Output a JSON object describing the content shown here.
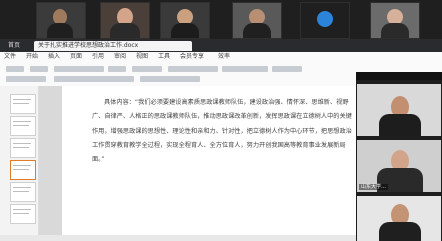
{
  "gallery": {
    "participants": [
      {
        "name": "",
        "label_icon": "user-video"
      },
      {
        "name": "",
        "label_icon": "user-video"
      },
      {
        "name": "",
        "label_icon": "user-video"
      },
      {
        "name": "",
        "label_icon": "user-video"
      },
      {
        "name": "",
        "label_icon": "user-video"
      },
      {
        "name": "",
        "label_icon": "user-video"
      },
      {
        "name": "",
        "label_icon": "user-video"
      },
      {
        "name": "",
        "label_icon": "user-video"
      }
    ]
  },
  "wps": {
    "tabs": [
      "首页",
      "关于扎实推进学校思想政治工作.docx"
    ],
    "menus": [
      "文件",
      "开始",
      "插入",
      "页面",
      "引用",
      "审阅",
      "视图",
      "工具",
      "会员专享",
      "效率"
    ],
    "doc": {
      "paragraph": "具体内容：“我们必须要建设高素质思政课教师队伍，建设政治强、情怀深、思维新、视野广、自律严、人格正的思政课教师队伍，推动思政课改革创新，发挥思政课在立德树人中的关键作用，增强思政课的思想性、理论性和亲和力、针对性，把立德树人作为中心环节，把思想政治工作贯穿教育教学全过程，实现全程育人、全方位育人，努力开创我国高等教育事业发展新局面。”"
    }
  },
  "right_panel": {
    "participants": [
      {
        "label": ""
      },
      {
        "label": "山东大学…"
      },
      {
        "label": ""
      }
    ]
  },
  "colors": {
    "accent": "#e07b2a",
    "wps_tabbar": "#2a2b2f"
  }
}
